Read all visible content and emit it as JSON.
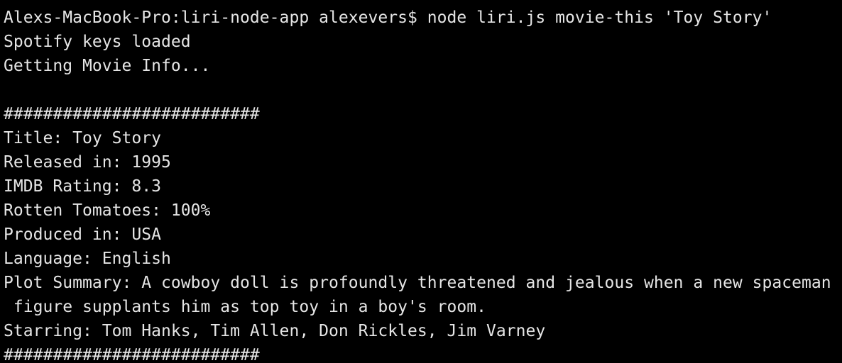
{
  "terminal": {
    "background": "#000000",
    "foreground": "#e5e5e5",
    "lines": [
      "Alexs-MacBook-Pro:liri-node-app alexevers$ node liri.js movie-this 'Toy Story'",
      "Spotify keys loaded",
      "Getting Movie Info...",
      "",
      "##########################",
      "Title: Toy Story",
      "Released in: 1995",
      "IMDB Rating: 8.3",
      "Rotten Tomatoes: 100%",
      "Produced in: USA",
      "Language: English",
      "Plot Summary: A cowboy doll is profoundly threatened and jealous when a new spaceman",
      " figure supplants him as top toy in a boy's room.",
      "Starring: Tom Hanks, Tim Allen, Don Rickles, Jim Varney",
      "##########################"
    ]
  }
}
